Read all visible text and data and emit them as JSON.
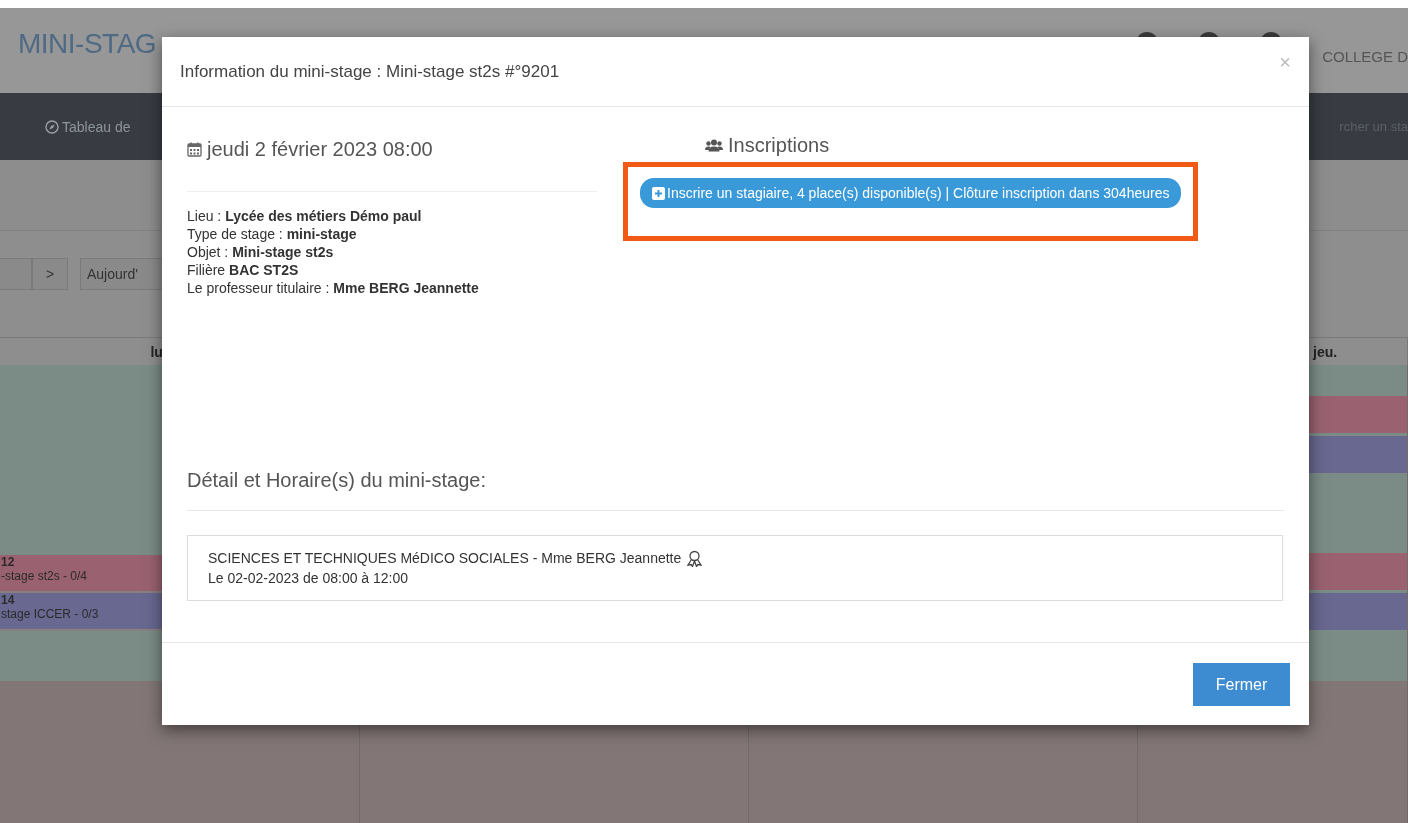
{
  "background": {
    "app_title": "MINI-STAG",
    "school": "COLLEGE D",
    "nav_item": "Tableau de",
    "search_placeholder": "rcher un sta",
    "toolbar": {
      "next_button": ">",
      "today_button": "Aujourd'"
    },
    "header_cells": [
      "lu",
      "jeu."
    ],
    "left_events": [
      {
        "time": "12",
        "title": "-stage st2s - 0/4",
        "color": "#9a6270"
      },
      {
        "time": "14",
        "title": "stage ICCER - 0/3",
        "color": "#686890"
      }
    ],
    "right_events": [
      {
        "color": "#9a6270"
      },
      {
        "color": "#686890"
      },
      {
        "color": "#9a6270"
      },
      {
        "color": "#686890"
      }
    ]
  },
  "modal": {
    "title": "Information du mini-stage : Mini-stage st2s #°9201",
    "close": "×",
    "date": "jeudi 2 février 2023 08:00",
    "details": [
      "Lieu : **Lycée des métiers Démo paul**",
      "Type de stage : **mini-stage**",
      "Objet : **Mini-stage st2s**",
      "Filière **BAC ST2S**",
      "Le professeur titulaire : **Mme BERG Jeannette**"
    ],
    "inscriptions_heading": "Inscriptions",
    "register_button": {
      "label": "Inscrire un stagiaire, 4 place(s) disponible(s) | Clôture inscription dans 304heures",
      "highlighted": true
    },
    "schedule_heading": "Détail et Horaire(s) du mini-stage:",
    "schedule": [
      {
        "subject": "SCIENCES ET TECHNIQUES MéDICO SOCIALES - Mme BERG Jeannette",
        "time": "Le 02-02-2023 de 08:00 à 12:00"
      }
    ],
    "close_button": "Fermer"
  }
}
